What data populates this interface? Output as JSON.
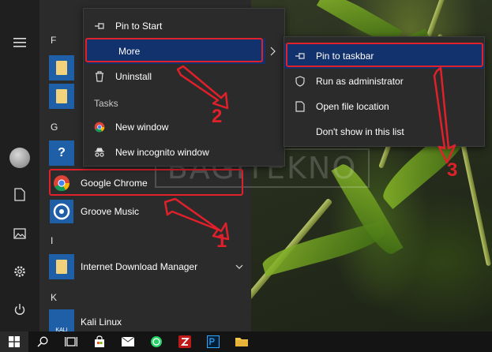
{
  "start_menu": {
    "letters": {
      "f": "F",
      "g": "G",
      "i": "I",
      "k": "K"
    },
    "apps": {
      "google_chrome": "Google Chrome",
      "groove_music": "Groove Music",
      "idm": "Internet Download Manager",
      "kali": "Kali Linux",
      "kali_tile_text": "KALI"
    }
  },
  "context_menu": {
    "pin_to_start": "Pin to Start",
    "more": "More",
    "uninstall": "Uninstall",
    "tasks_header": "Tasks",
    "new_window": "New window",
    "new_incognito": "New incognito window"
  },
  "submenu": {
    "pin_to_taskbar": "Pin to taskbar",
    "run_as_admin": "Run as administrator",
    "open_file_location": "Open file location",
    "dont_show": "Don't show in this list"
  },
  "watermark": "BAGITEKNO",
  "annotations": {
    "one": "1",
    "two": "2",
    "three": "3"
  },
  "colors": {
    "highlight": "#12326e",
    "annotation_red": "#e0202a",
    "menu_bg": "#2b2b2b"
  }
}
